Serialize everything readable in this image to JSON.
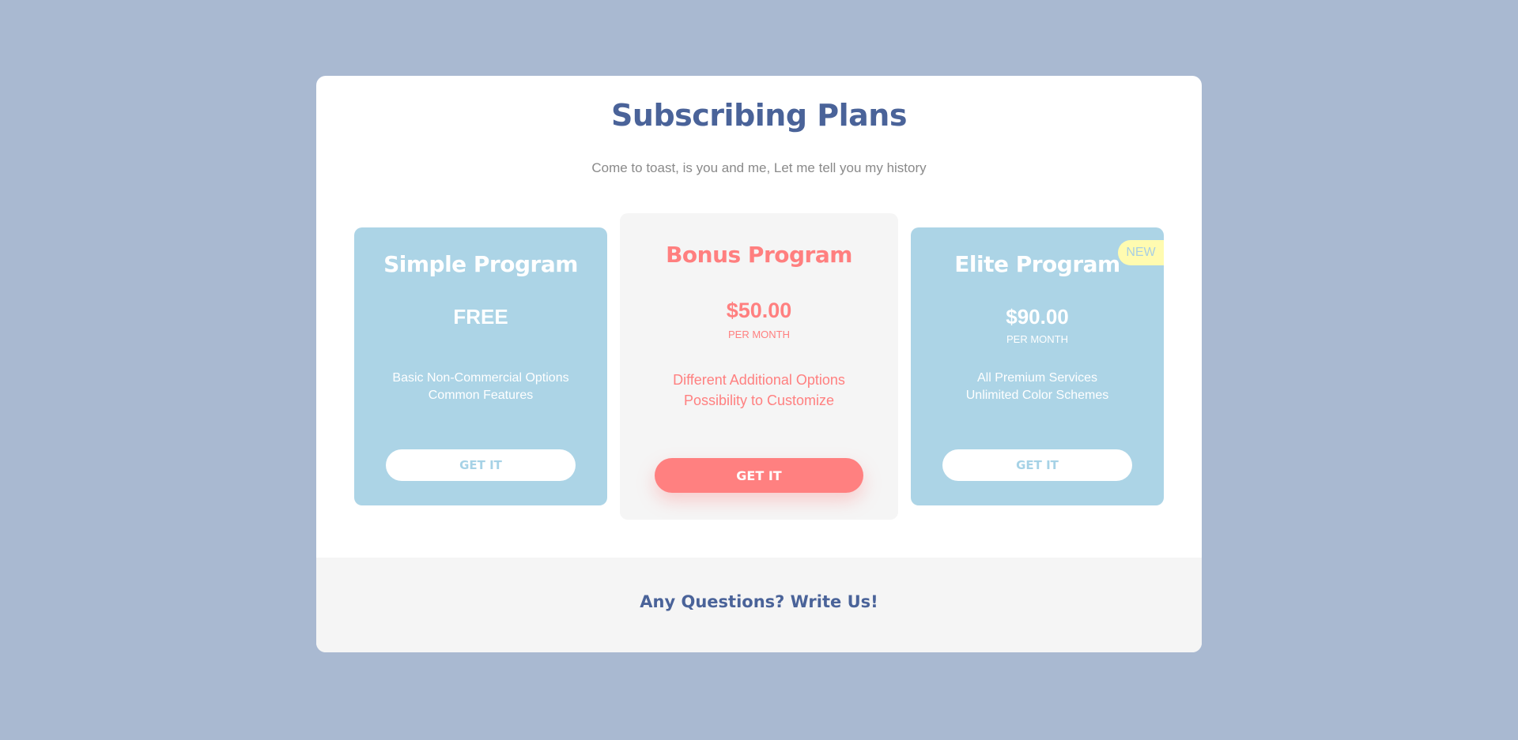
{
  "header": {
    "title": "Subscribing Plans",
    "subtitle": "Come to toast, is you and me, Let me tell you my history"
  },
  "plans": [
    {
      "name": "Simple Program",
      "price": "FREE",
      "period": "",
      "features": [
        "Basic Non-Commercial Options",
        "Common Features"
      ],
      "button_label": "GET IT"
    },
    {
      "name": "Bonus Program",
      "price": "$50.00",
      "period": "PER MONTH",
      "features": [
        "Different Additional Options",
        "Possibility to Customize"
      ],
      "button_label": "GET IT"
    },
    {
      "name": "Elite Program",
      "price": "$90.00",
      "period": "PER MONTH",
      "features": [
        "All Premium Services",
        "Unlimited Color Schemes"
      ],
      "button_label": "GET IT",
      "badge": "NEW"
    }
  ],
  "footer": {
    "link_text": "Any Questions? Write Us!"
  },
  "colors": {
    "background": "#a9b9d1",
    "primary_text": "#4a6399",
    "side_card": "#acd4e6",
    "accent": "#ff8080",
    "badge": "#fffbb0"
  }
}
